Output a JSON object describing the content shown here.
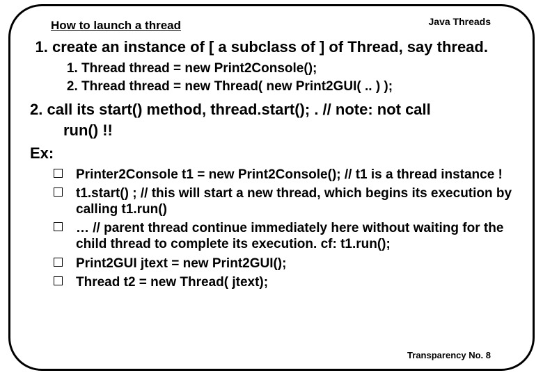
{
  "header": {
    "topic": "Java Threads"
  },
  "title": "How to launch a thread",
  "steps": {
    "one": "create an instance of [ a subclass of ] of Thread, say thread.",
    "one_sub": [
      "Thread thread = new Print2Console();",
      "Thread thread = new Thread( new Print2GUI( .. ) );"
    ],
    "two_number": "2.",
    "two_line1": "call its start() method, thread.start(); . // note: not call",
    "two_line2": "run() !!"
  },
  "ex_label": "Ex:",
  "ex_items": [
    "Printer2Console t1 = new Print2Console();  // t1 is a thread instance !",
    "t1.start() ; // this will start a new thread, which begins its execution by calling t1.run()",
    "… // parent thread continue immediately here without waiting for the child thread to complete its execution. cf: t1.run();",
    "Print2GUI jtext = new Print2GUI();",
    "Thread t2 = new Thread( jtext);"
  ],
  "footer": {
    "page": "Transparency No. 8"
  }
}
